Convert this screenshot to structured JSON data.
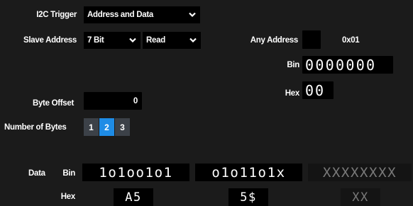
{
  "trigger": {
    "type_label": "I2C Trigger",
    "type_value": "Address and Data"
  },
  "slave": {
    "label": "Slave Address",
    "bits_value": "7 Bit",
    "rw_value": "Read"
  },
  "address": {
    "any_label": "Any Address",
    "value": "0x01",
    "bin_label": "Bin",
    "bin_value": "0000000",
    "hex_label": "Hex",
    "hex_value": "00"
  },
  "offset": {
    "label": "Byte Offset",
    "value": "0"
  },
  "num_bytes": {
    "label": "Number of Bytes",
    "options": [
      "1",
      "2",
      "3"
    ],
    "selected": "2"
  },
  "data": {
    "label": "Data",
    "bin_label": "Bin",
    "hex_label": "Hex",
    "bytes": [
      {
        "bin": "1o1oo1o1",
        "hex": "A5"
      },
      {
        "bin": "o1o11o1x",
        "hex": "5$"
      },
      {
        "bin": "XXXXXXXX",
        "hex": "XX"
      }
    ]
  },
  "colors": {
    "background": "#1b1b1b",
    "field": "#000000",
    "segment": "#3c4148",
    "segment_active": "#1e8ce6",
    "disabled_text": "#7a7a7a"
  }
}
